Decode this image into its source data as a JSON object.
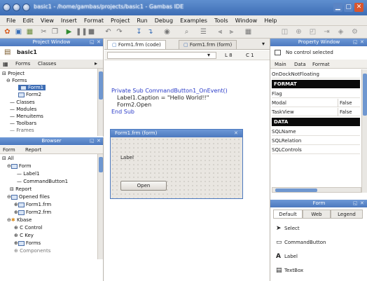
{
  "window": {
    "title": "basic1 - /home/gambas/projects/basic1 - Gambas IDE"
  },
  "menu": [
    "File",
    "Edit",
    "View",
    "Insert",
    "Format",
    "Project",
    "Run",
    "Debug",
    "Examples",
    "Tools",
    "Window",
    "Help"
  ],
  "project_panel": {
    "header": "Project Window",
    "project_name": "basic1",
    "tabs": [
      "Forms",
      "Classes"
    ],
    "tree": [
      "Project",
      "Forms",
      "Form1",
      "Form2",
      "Classes",
      "Modules",
      "Menuitems",
      "Toolbars",
      "Frames"
    ]
  },
  "browser_panel": {
    "header": "Browser",
    "tabs": [
      "Form",
      "Report"
    ],
    "tree": [
      "All",
      "Form",
      "Label1",
      "CommandButton1",
      "Report",
      "Opened files",
      "Form1.frm",
      "Form2.frm",
      "Kbase",
      "Control",
      "Key",
      "Forms",
      "Components"
    ]
  },
  "editor": {
    "tabs": [
      "Form1.frm (code)",
      "Form1.frm (form)"
    ],
    "position": [
      "L 8",
      "C 1"
    ],
    "code": [
      {
        "kw": "Private Sub ",
        "rest": "CommandButton1_OnEvent()"
      },
      {
        "kw": "",
        "rest": "Label1.Caption = \"Hello World!!\""
      },
      {
        "kw": "",
        "rest": "Form2.Open"
      },
      {
        "kw": "End Sub",
        "rest": ""
      }
    ]
  },
  "form_designer": {
    "title": "Form1.frm (form)",
    "label_caption": "Label",
    "button_caption": "Open"
  },
  "properties_panel": {
    "header": "Property Window",
    "status": "No control selected",
    "tabs": [
      "Main",
      "Data",
      "Format"
    ],
    "rows": [
      {
        "type": "row",
        "name": "OnDockNotFloating",
        "value": ""
      },
      {
        "type": "section",
        "name": "FORMAT"
      },
      {
        "type": "row",
        "name": "Flag",
        "value": ""
      },
      {
        "type": "row",
        "name": "Modal",
        "value": "False"
      },
      {
        "type": "row",
        "name": "TaskView",
        "value": "False"
      },
      {
        "type": "section",
        "name": "DATA"
      },
      {
        "type": "row",
        "name": "SQLName",
        "value": ""
      },
      {
        "type": "row",
        "name": "SQLRelation",
        "value": ""
      },
      {
        "type": "row",
        "name": "SQLControls",
        "value": ""
      }
    ]
  },
  "toolbox_panel": {
    "header": "Form",
    "tabs": [
      "Default",
      "Web",
      "Legend"
    ],
    "items": [
      {
        "icon": "arrow-cursor-icon",
        "glyph": "➤",
        "label": "Select"
      },
      {
        "icon": "command-button-icon",
        "glyph": "▭",
        "label": "CommandButton"
      },
      {
        "icon": "label-icon",
        "glyph": "A",
        "label": "Label"
      },
      {
        "icon": "textbox-icon",
        "glyph": "▤",
        "label": "TextBox"
      }
    ]
  },
  "colors": {
    "titlebar": "#4a7cc2",
    "panel_header": "#5b88cb",
    "keyword": "#2a3bc8",
    "section_black": "#0b0b0b"
  }
}
